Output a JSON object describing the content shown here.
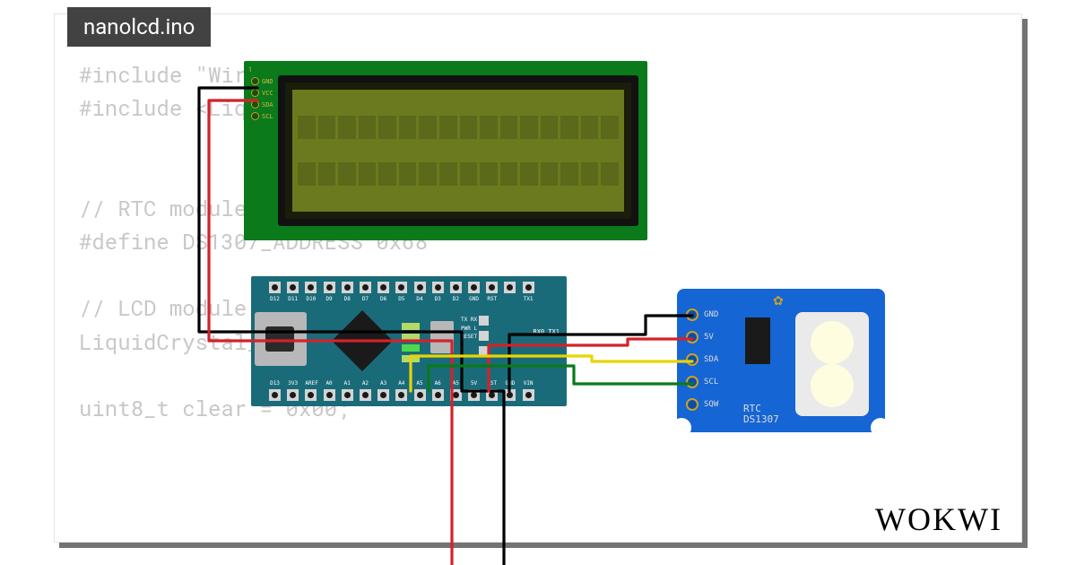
{
  "filename": "nanolcd.ino",
  "watermark": "WOKWI",
  "code": "#include \"Wire.h\"\n#include <LiquidCrystal_I2C.h>\n\n\n// RTC module at address 0x68\n#define DS1307_ADDRESS 0x68\n\n// LCD module at address 0x27\nLiquidCrystal_I2C lcd(0x27, 20, 4);\n\nuint8_t clear = 0x00;",
  "lcd": {
    "pin1": "1",
    "pins": [
      "GND",
      "VCC",
      "SDA",
      "SCL"
    ],
    "cols": 16,
    "rows": 2
  },
  "nano": {
    "top_labels": [
      "D12",
      "D11",
      "D10",
      "D9",
      "D8",
      "D7",
      "D6",
      "D5",
      "D4",
      "D3",
      "D2",
      "GND",
      "RST",
      "",
      "TX1"
    ],
    "bottom_labels": [
      "D13",
      "3V3",
      "AREF",
      "A0",
      "A1",
      "A2",
      "A3",
      "A4",
      "A5",
      "A6",
      "A5",
      "5V",
      "RST",
      "GND",
      "VIN"
    ],
    "mid_block": "TX RX\nPWR L\nRESET",
    "rx_label": "RX0 TX1"
  },
  "rtc": {
    "pins": [
      "GND",
      "5V",
      "SDA",
      "SCL",
      "SQW"
    ],
    "label_top": "RTC",
    "label_bottom": "DS1307"
  },
  "wires": [
    {
      "name": "lcd-gnd-to-nano-gnd",
      "color": "#000000"
    },
    {
      "name": "lcd-vcc-to-nano-5v",
      "color": "#d3222a"
    },
    {
      "name": "rtc-gnd-to-nano-gnd",
      "color": "#000000"
    },
    {
      "name": "rtc-5v-to-nano-5v",
      "color": "#d3222a"
    },
    {
      "name": "rtc-sda-to-nano-a4",
      "color": "#e8d500"
    },
    {
      "name": "rtc-scl-to-nano-a5",
      "color": "#0a7a1a"
    }
  ]
}
